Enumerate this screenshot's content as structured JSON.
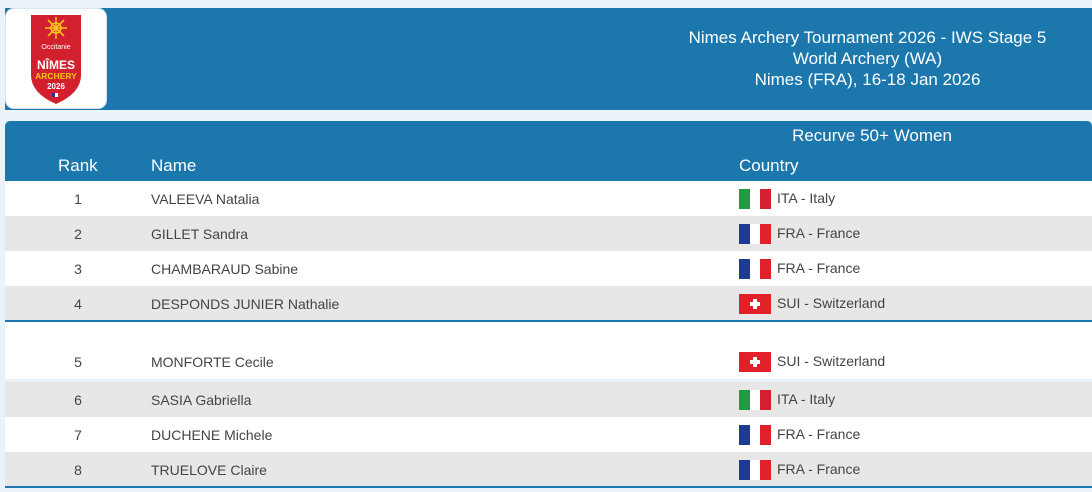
{
  "logo": {
    "region": "Occitanie",
    "line1": "NÎMES",
    "line2": "ARCHERY",
    "year": "2026"
  },
  "event": {
    "title": "Nimes Archery Tournament 2026 - IWS Stage 5",
    "organizer": "World Archery (WA)",
    "place_date": "Nimes (FRA), 16-18 Jan 2026"
  },
  "table": {
    "category": "Recurve 50+ Women",
    "headers": {
      "rank": "Rank",
      "name": "Name",
      "country": "Country"
    },
    "rows": [
      {
        "rank": "1",
        "name": "VALEEVA Natalia",
        "country": "ITA - Italy",
        "flag": "ITA"
      },
      {
        "rank": "2",
        "name": "GILLET Sandra",
        "country": "FRA - France",
        "flag": "FRA"
      },
      {
        "rank": "3",
        "name": "CHAMBARAUD Sabine",
        "country": "FRA - France",
        "flag": "FRA"
      },
      {
        "rank": "4",
        "name": "DESPONDS JUNIER Nathalie",
        "country": "SUI - Switzerland",
        "flag": "SUI"
      },
      {
        "rank": "5",
        "name": "MONFORTE Cecile",
        "country": "SUI - Switzerland",
        "flag": "SUI"
      },
      {
        "rank": "6",
        "name": "SASIA Gabriella",
        "country": "ITA - Italy",
        "flag": "ITA"
      },
      {
        "rank": "7",
        "name": "DUCHENE Michele",
        "country": "FRA - France",
        "flag": "FRA"
      },
      {
        "rank": "8",
        "name": "TRUELOVE Claire",
        "country": "FRA - France",
        "flag": "FRA"
      }
    ]
  },
  "colors": {
    "header_blue": "#1c77ac",
    "row_alt": "#e7e7e7",
    "logo_red": "#d2202f",
    "logo_yellow": "#f6c21a"
  }
}
